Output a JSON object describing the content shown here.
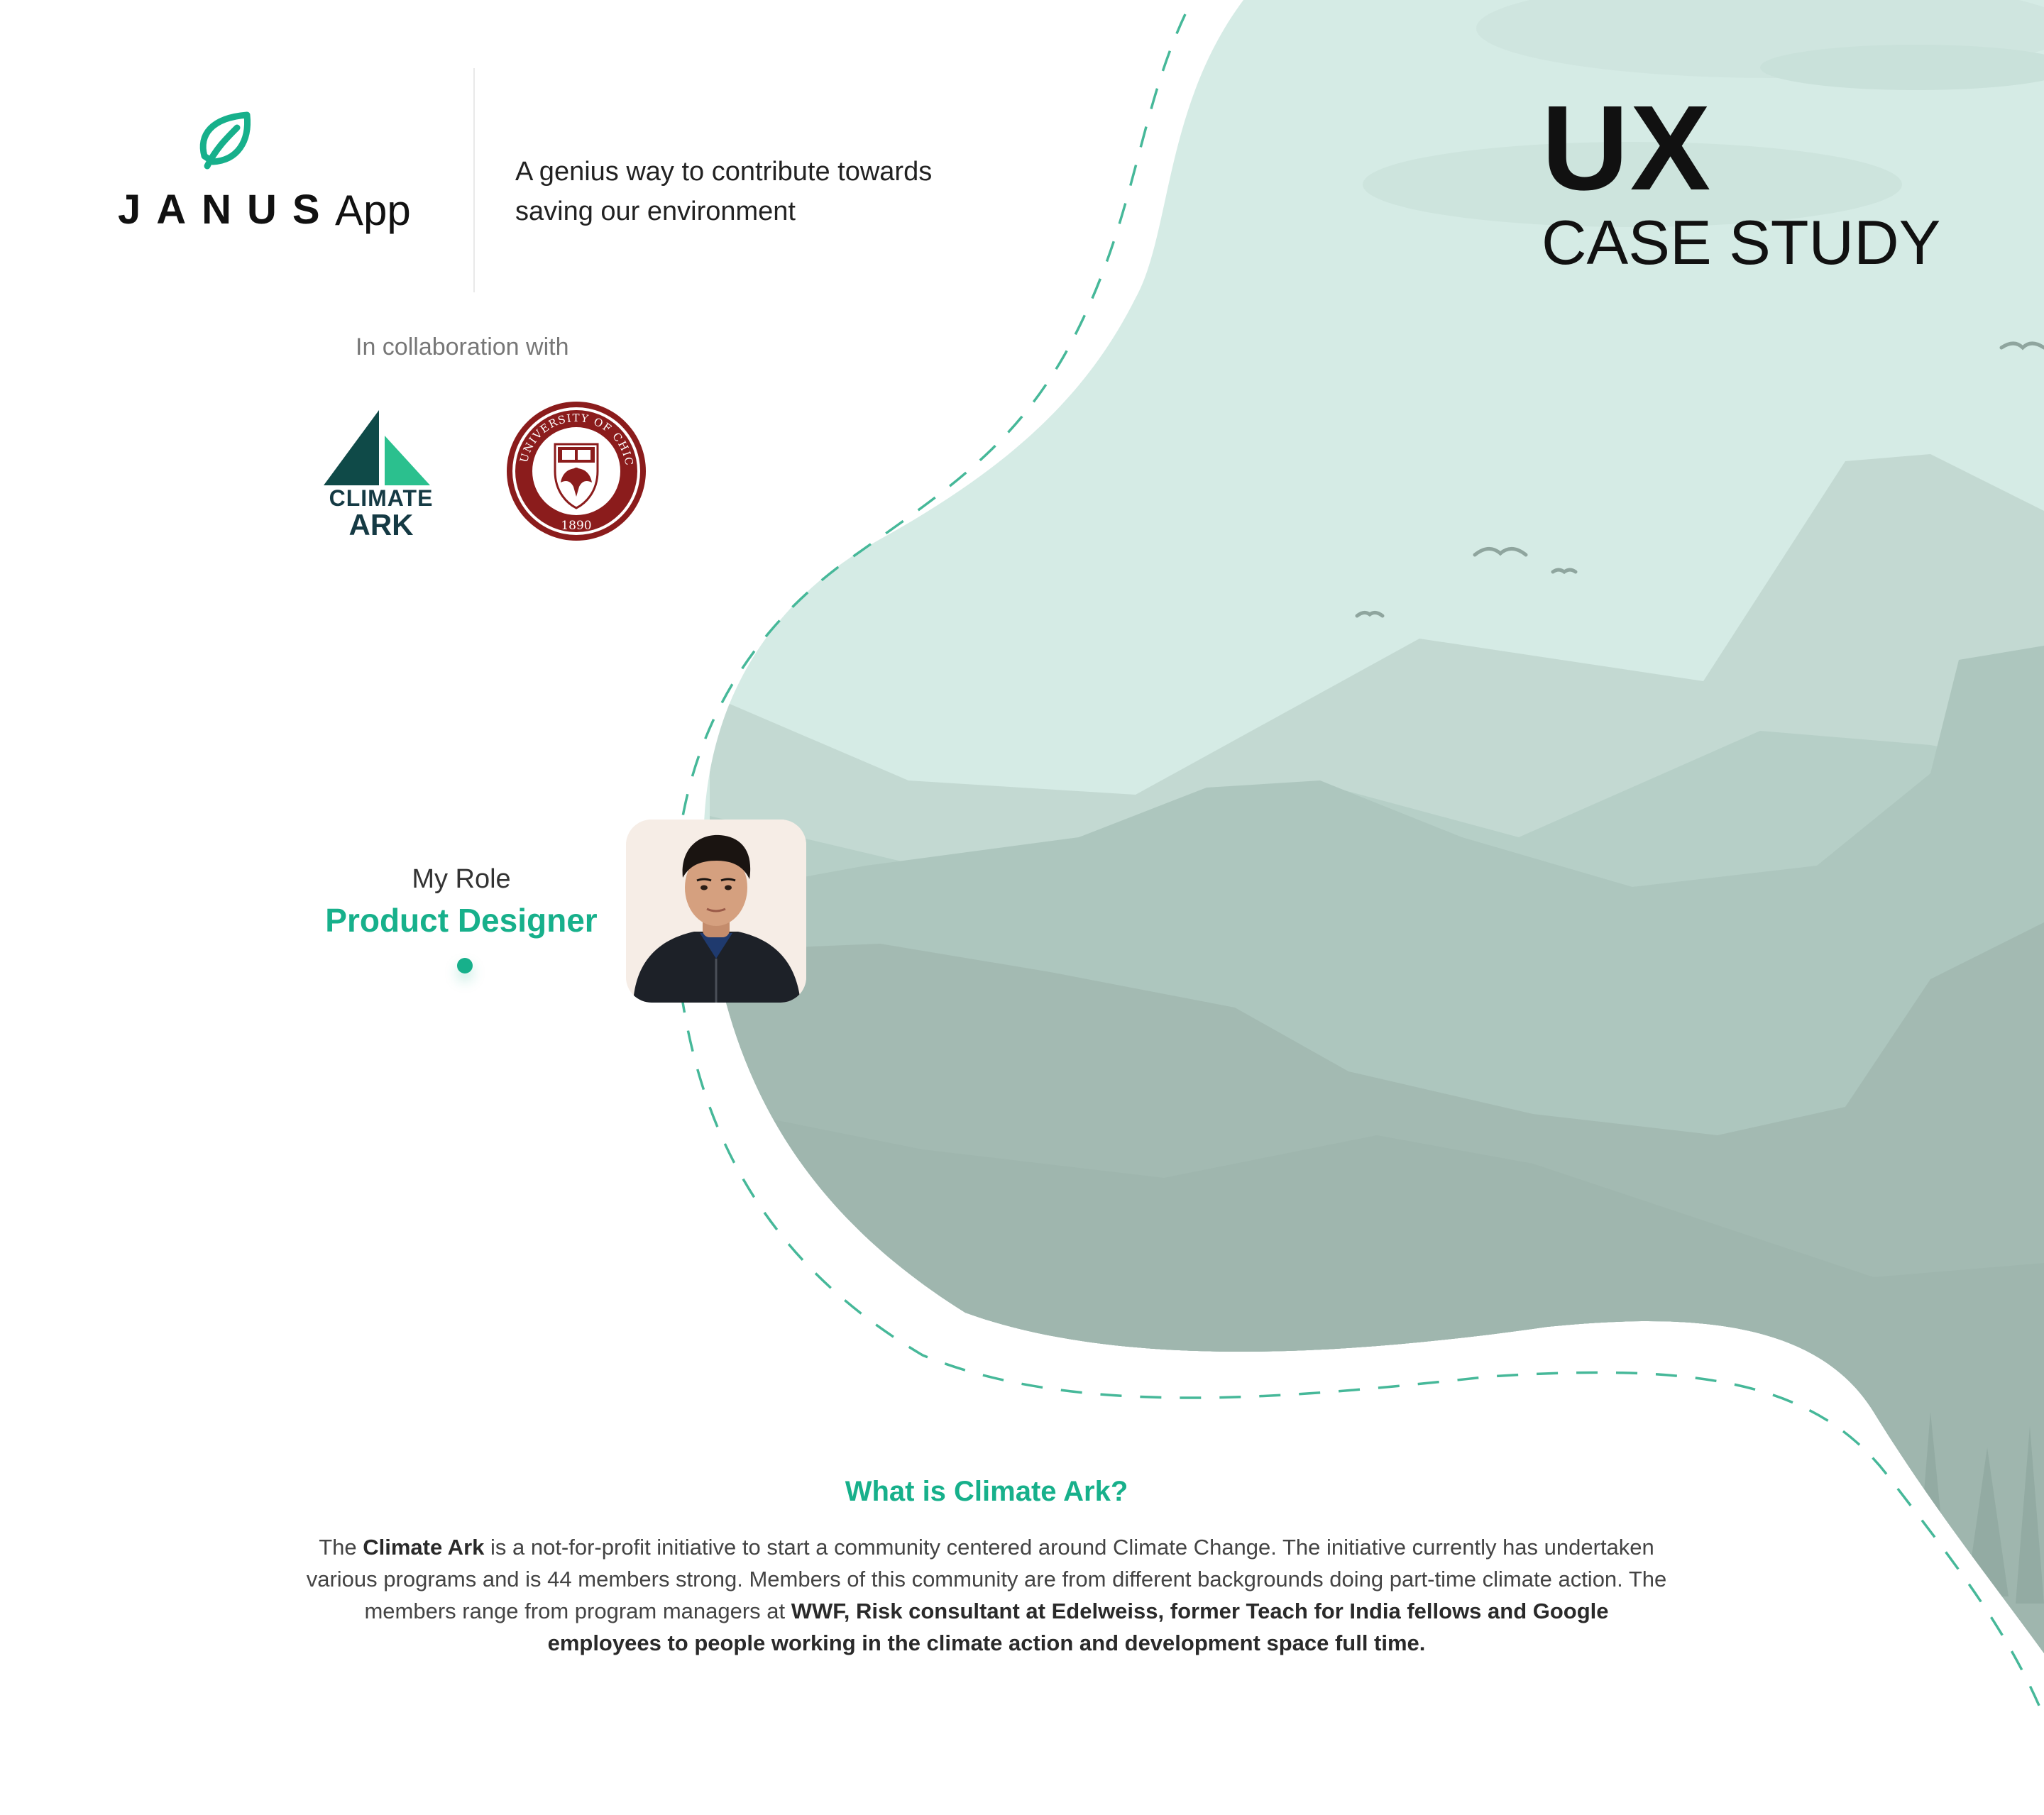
{
  "brand": {
    "name": "JANUS",
    "suffix": "App",
    "logo_icon": "leaf-icon",
    "tagline": "A genius way to contribute towards saving our environment"
  },
  "hero": {
    "title_line1": "UX",
    "title_line2": "CASE STUDY"
  },
  "collaboration": {
    "label": "In collaboration with",
    "partners": [
      {
        "name_line1": "CLIMATE",
        "name_line2": "ARK",
        "logo_icon": "climate-ark-sails-logo"
      },
      {
        "name": "THE UNIVERSITY OF CHICAGO",
        "year": "1890",
        "logo_icon": "university-of-chicago-seal"
      }
    ]
  },
  "role": {
    "label": "My Role",
    "title": "Product Designer",
    "avatar_icon": "designer-avatar"
  },
  "about": {
    "heading": "What is Climate Ark?",
    "p1": "The ",
    "p2": "Climate Ark",
    "p3": " is a not-for-profit initiative to start a community centered around Climate Change. The initiative currently has undertaken various programs and is 44 members strong. Members of this community are from different backgrounds doing part-time climate action. The members range from program managers at ",
    "p4": "WWF, Risk consultant at Edelweiss, former Teach for India fellows and Google employees to people working in the climate action and development space full time."
  },
  "colors": {
    "accent": "#17b08b",
    "sky": "#d5ebe5",
    "mountain_far": "#bcd5cd",
    "mountain_mid": "#acc6bd",
    "mountain_near": "#a2b9b1",
    "seal": "#8b1c1c"
  }
}
